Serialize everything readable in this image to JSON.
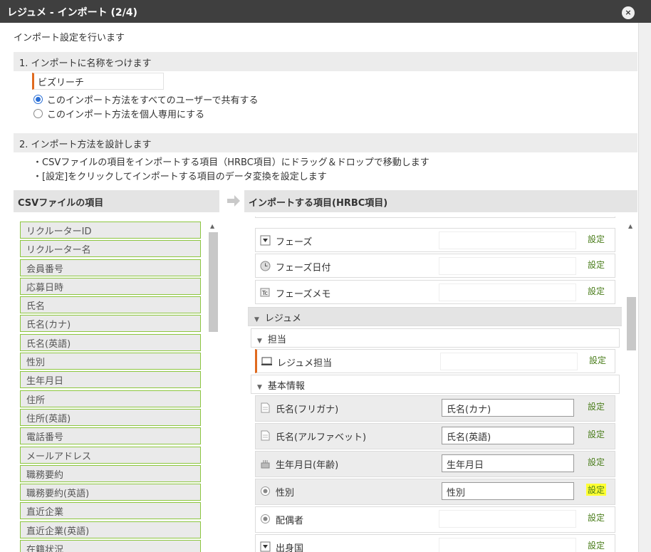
{
  "dialog": {
    "title": "レジュメ - インポート (2/4)",
    "close_icon": "×"
  },
  "intro": "インポート設定を行います",
  "section1": {
    "heading": "1. インポートに名称をつけます",
    "name_value": "ビズリーチ",
    "radios": [
      {
        "label": "このインポート方法をすべてのユーザーで共有する",
        "checked": true
      },
      {
        "label": "このインポート方法を個人専用にする",
        "checked": false
      }
    ]
  },
  "section2": {
    "heading": "2. インポート方法を設計します",
    "notes": [
      "・CSVファイルの項目をインポートする項目（HRBC項目）にドラッグ＆ドロップで移動します",
      "・[設定]をクリックしてインポートする項目のデータ変換を設定します"
    ]
  },
  "csv_column": {
    "heading": "CSVファイルの項目",
    "items": [
      "リクルーターID",
      "リクルーター名",
      "会員番号",
      "応募日時",
      "氏名",
      "氏名(カナ)",
      "氏名(英語)",
      "性別",
      "生年月日",
      "住所",
      "住所(英語)",
      "電話番号",
      "メールアドレス",
      "職務要約",
      "職務要約(英語)",
      "直近企業",
      "直近企業(英語)",
      "在籍状況"
    ]
  },
  "hrbc_column": {
    "heading": "インポートする項目(HRBC項目)",
    "set_label": "設定",
    "fields_top": [
      {
        "label": "フェーズ",
        "icon": "dropdown-icon",
        "value": ""
      },
      {
        "label": "フェーズ日付",
        "icon": "clock-icon",
        "value": ""
      },
      {
        "label": "フェーズメモ",
        "icon": "memo-icon",
        "value": ""
      }
    ],
    "group_resume": "レジュメ",
    "group_owner": "担当",
    "owner_field": {
      "label": "レジュメ担当",
      "icon": "computer-icon",
      "value": ""
    },
    "group_basic": "基本情報",
    "basic_fields": [
      {
        "label": "氏名(フリガナ)",
        "icon": "document-icon",
        "value": "氏名(カナ)"
      },
      {
        "label": "氏名(アルファベット)",
        "icon": "document-icon",
        "value": "氏名(英語)"
      },
      {
        "label": "生年月日(年齢)",
        "icon": "cake-icon",
        "value": "生年月日"
      },
      {
        "label": "性別",
        "icon": "radio-icon",
        "value": "性別"
      },
      {
        "label": "配偶者",
        "icon": "radio-icon",
        "value": ""
      },
      {
        "label": "出身国",
        "icon": "dropdown-icon",
        "value": ""
      }
    ]
  },
  "colors": {
    "accent_orange": "#e06a1f",
    "csv_border_green": "#8cc63f",
    "link_green": "#4a7d1b",
    "highlight_yellow": "#ffff33",
    "titlebar": "#3f3f3f"
  }
}
